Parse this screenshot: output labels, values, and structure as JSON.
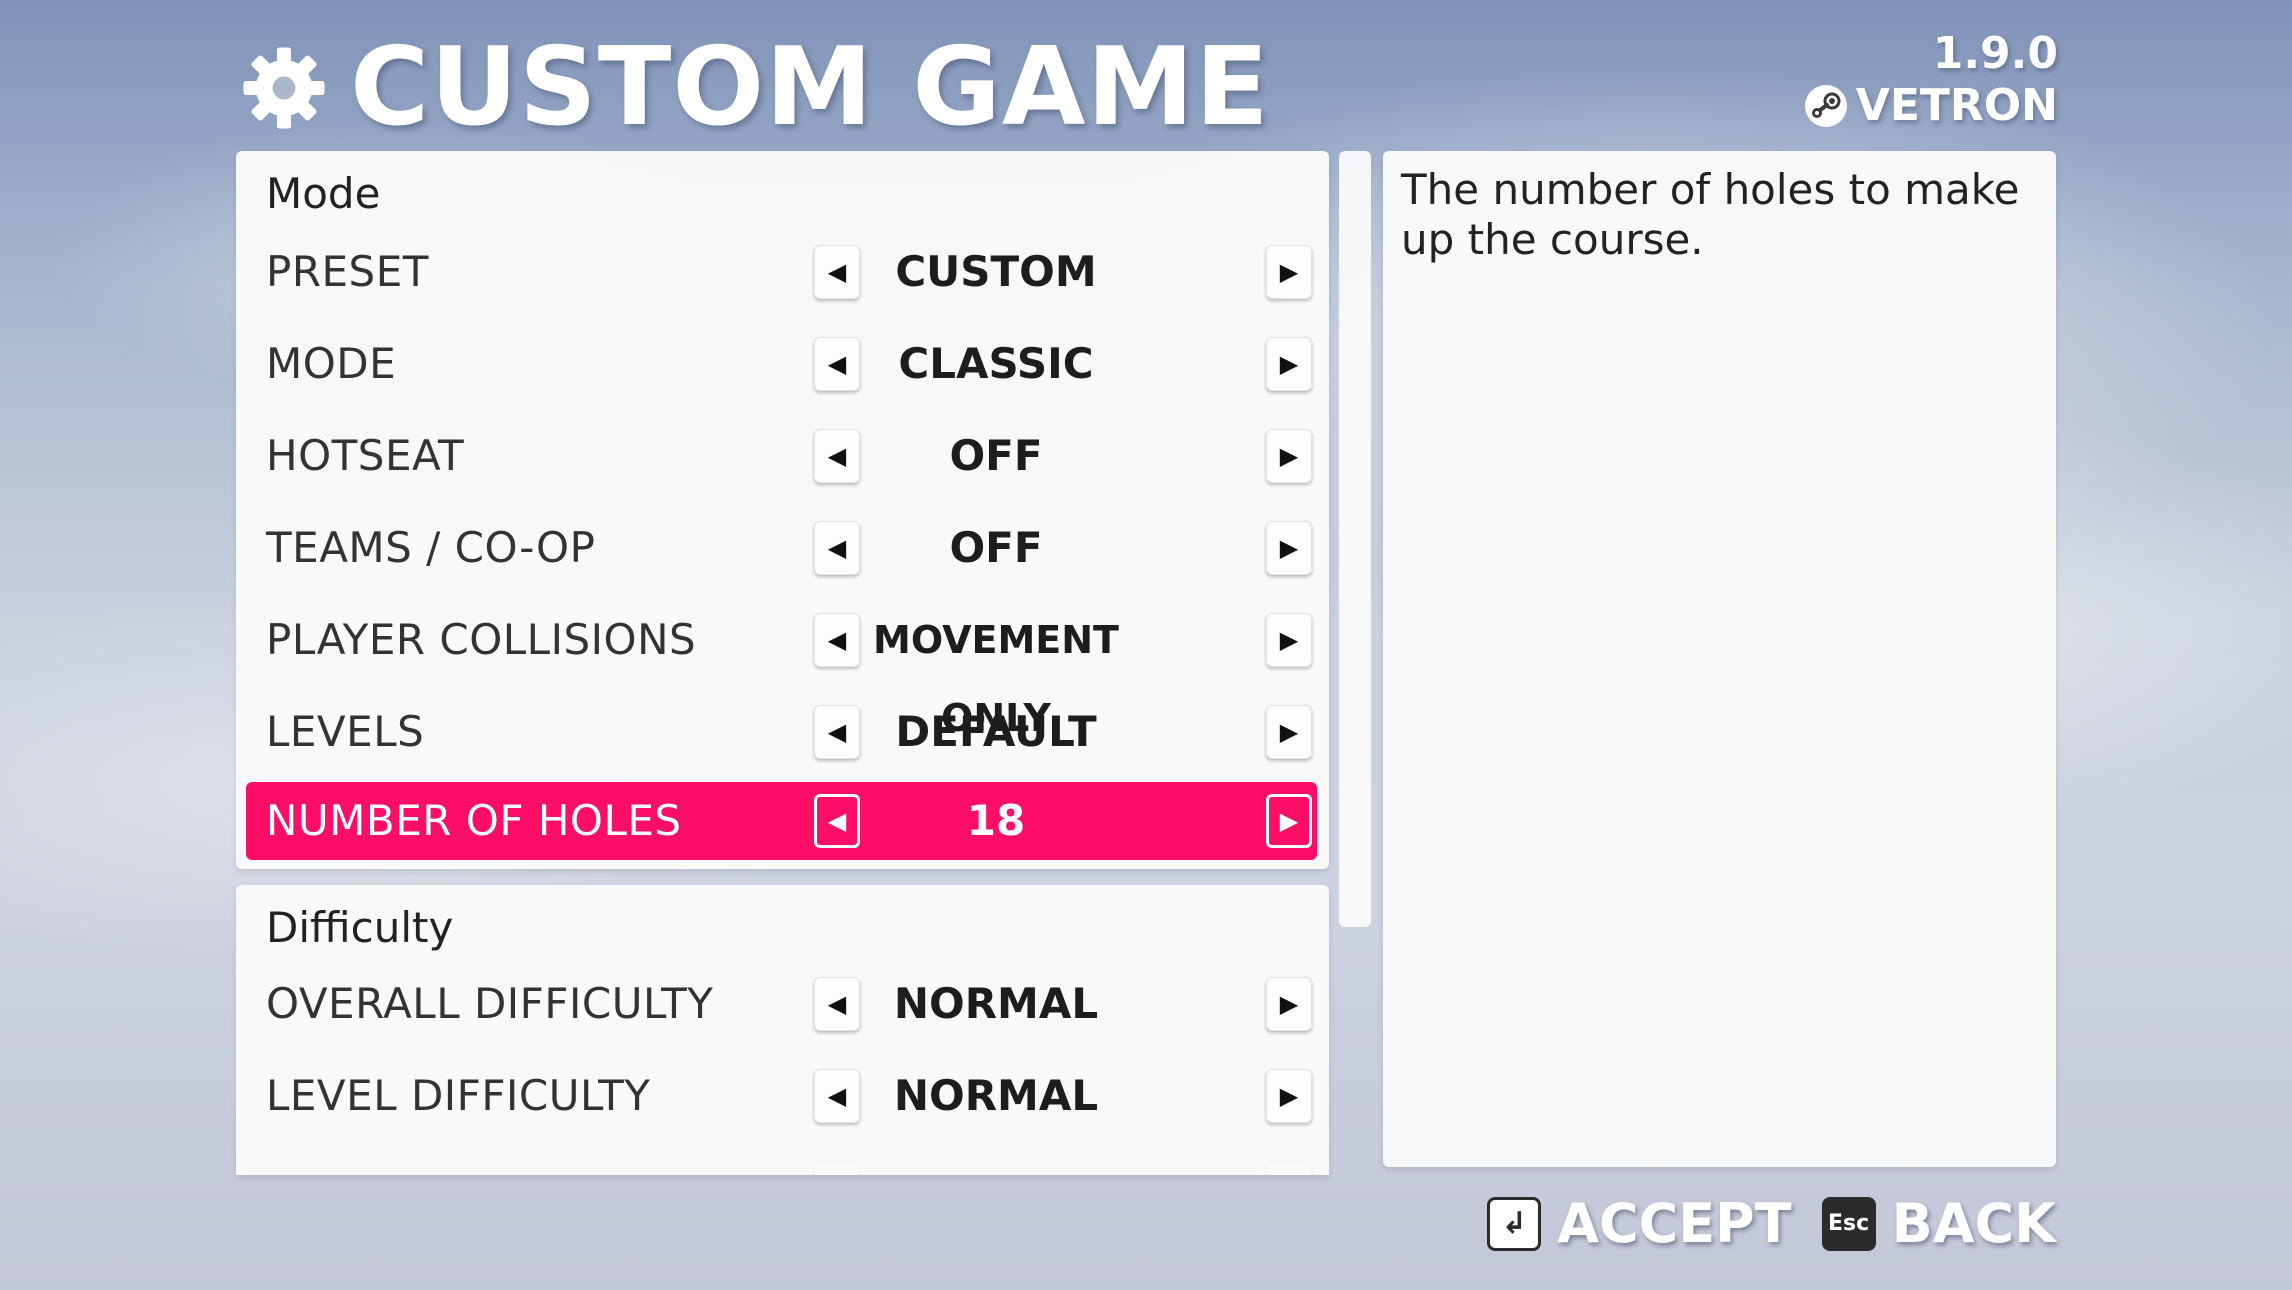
{
  "header": {
    "title": "CUSTOM GAME",
    "version": "1.9.0",
    "username": "VETRON"
  },
  "mode_section": {
    "title": "Mode",
    "rows": [
      {
        "label": "PRESET",
        "value": "CUSTOM"
      },
      {
        "label": "MODE",
        "value": "CLASSIC"
      },
      {
        "label": "HOTSEAT",
        "value": "OFF"
      },
      {
        "label": "TEAMS / CO-OP",
        "value": "OFF"
      },
      {
        "label": "PLAYER COLLISIONS",
        "value": "MOVEMENT ONLY"
      },
      {
        "label": "LEVELS",
        "value": "DEFAULT"
      },
      {
        "label": "NUMBER OF HOLES",
        "value": "18"
      }
    ]
  },
  "difficulty_section": {
    "title": "Difficulty",
    "rows": [
      {
        "label": "OVERALL DIFFICULTY",
        "value": "NORMAL"
      },
      {
        "label": "LEVEL DIFFICULTY",
        "value": "NORMAL"
      }
    ]
  },
  "description": "The number of holes to make up the course.",
  "footer": {
    "accept_label": "ACCEPT",
    "back_label": "BACK",
    "back_key": "Esc"
  },
  "colors": {
    "selected_row": "#ff0e67",
    "panel_bg": "#fafafb"
  },
  "icons": {
    "title": "gear-icon",
    "user": "steam-icon",
    "accept_key": "enter-key-icon",
    "back_key": "esc-key-icon",
    "arrow_left": "left-arrow-icon",
    "arrow_right": "right-arrow-icon"
  }
}
